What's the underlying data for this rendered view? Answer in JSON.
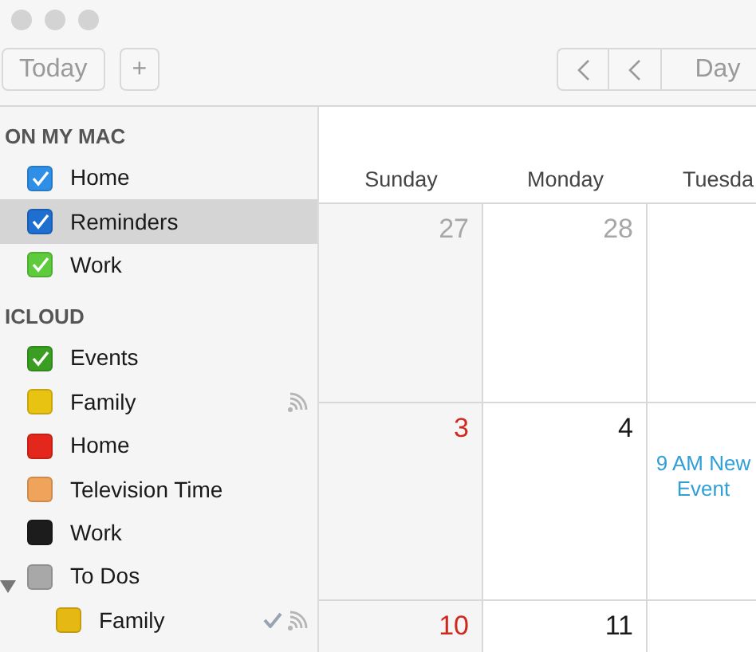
{
  "toolbar": {
    "today": "Today",
    "add": "+",
    "view": "Day"
  },
  "sidebar": {
    "sections": [
      {
        "title": "ON MY MAC",
        "calendars": [
          {
            "name": "Home",
            "color": "#2f8ee6",
            "checked": true,
            "selected": false,
            "shared": false,
            "done": false
          },
          {
            "name": "Reminders",
            "color": "#1f6fd1",
            "checked": true,
            "selected": true,
            "shared": false,
            "done": false
          },
          {
            "name": "Work",
            "color": "#5ecb3c",
            "checked": true,
            "selected": false,
            "shared": false,
            "done": false
          }
        ]
      },
      {
        "title": "ICLOUD",
        "calendars": [
          {
            "name": "Events",
            "color": "#3a9e22",
            "checked": true,
            "selected": false,
            "shared": false,
            "done": false
          },
          {
            "name": "Family",
            "color": "#e9c311",
            "checked": false,
            "selected": false,
            "shared": true,
            "done": false
          },
          {
            "name": "Home",
            "color": "#e4271c",
            "checked": false,
            "selected": false,
            "shared": false,
            "done": false
          },
          {
            "name": "Television Time",
            "color": "#f0a35a",
            "checked": false,
            "selected": false,
            "shared": false,
            "done": false
          },
          {
            "name": "Work",
            "color": "#1c1c1c",
            "checked": false,
            "selected": false,
            "shared": false,
            "done": false
          },
          {
            "name": "To Dos",
            "color": "#a8a8a8",
            "checked": false,
            "selected": false,
            "shared": false,
            "done": false,
            "expanded": true,
            "children": [
              {
                "name": "Family",
                "color": "#e6b814",
                "checked": false,
                "selected": false,
                "shared": true,
                "done": true
              }
            ]
          }
        ]
      }
    ]
  },
  "calendar": {
    "weekdays": [
      "Sunday",
      "Monday",
      "Tuesda"
    ],
    "weeks": [
      [
        {
          "date": "27",
          "kind": "other"
        },
        {
          "date": "28",
          "kind": "other"
        },
        {
          "kind": "blank"
        }
      ],
      [
        {
          "date": "3",
          "kind": "weekend"
        },
        {
          "date": "4",
          "kind": "weekday"
        },
        {
          "kind": "blank",
          "events": [
            "9 AM New Event"
          ]
        }
      ],
      [
        {
          "date": "10",
          "kind": "weekend"
        },
        {
          "date": "11",
          "kind": "weekday"
        },
        {
          "kind": "blank"
        }
      ]
    ]
  }
}
